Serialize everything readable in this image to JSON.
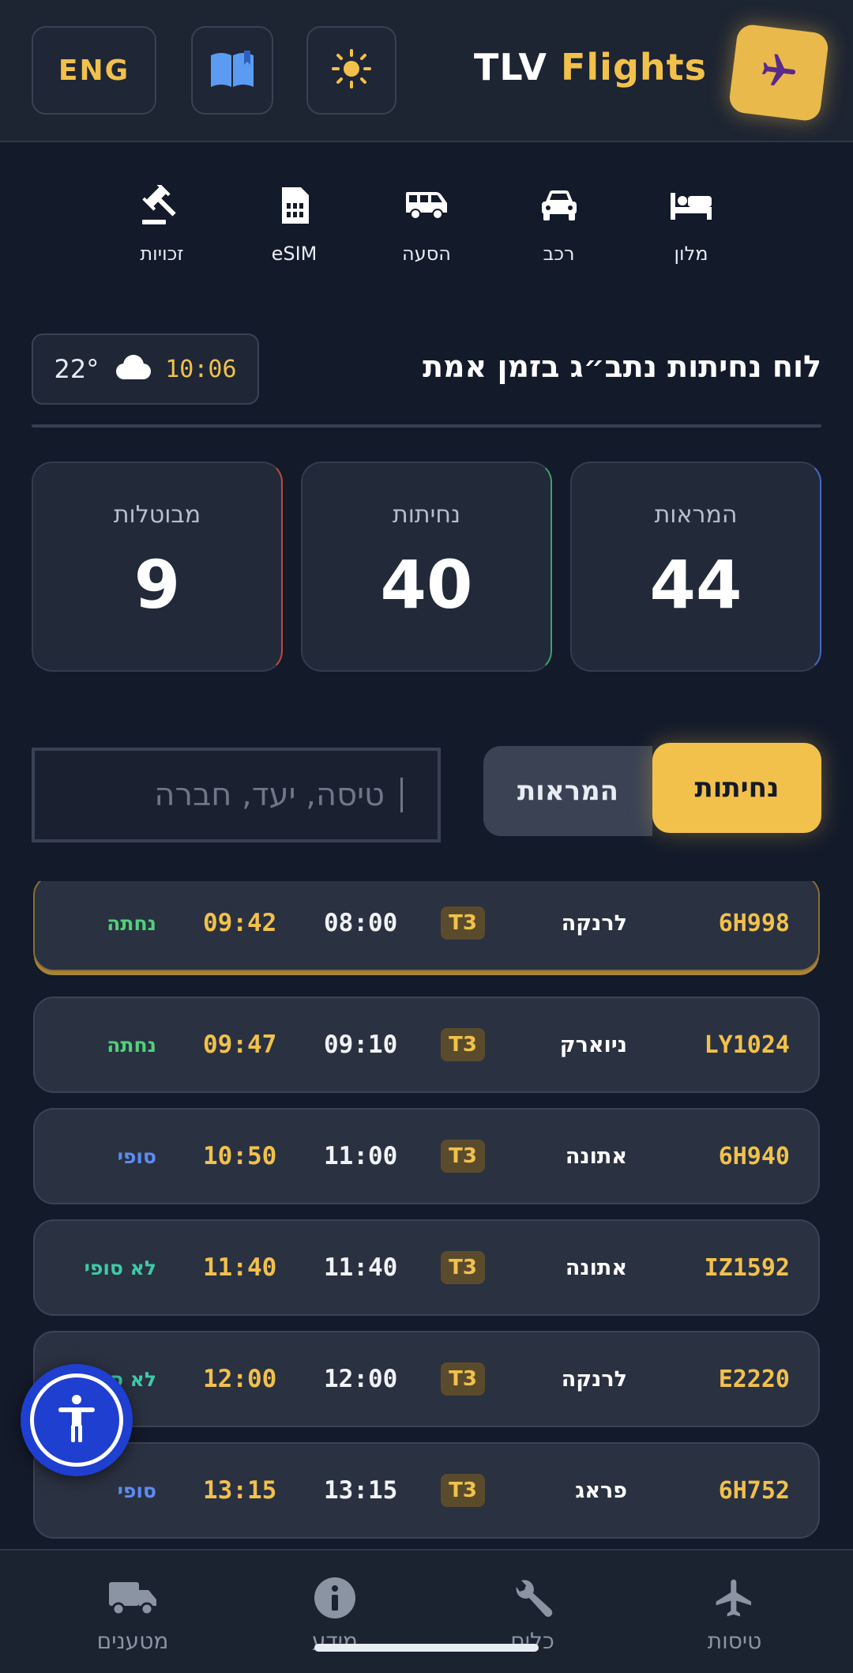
{
  "header": {
    "brand_prefix": "TLV",
    "brand_accent": "Flights",
    "language_button": "ENG",
    "guide_icon": "book-icon",
    "theme_icon": "sun-icon",
    "logo_icon": "airplane-icon"
  },
  "services": [
    {
      "label": "מלון",
      "icon": "bed-icon"
    },
    {
      "label": "רכב",
      "icon": "car-icon"
    },
    {
      "label": "הסעה",
      "icon": "shuttle-bus-icon"
    },
    {
      "label": "eSIM",
      "icon": "sim-card-icon"
    },
    {
      "label": "זכויות",
      "icon": "gavel-icon"
    }
  ],
  "board": {
    "title": "לוח נחיתות נתב״ג בזמן אמת",
    "clock": "10:06",
    "temperature": "22°",
    "weather_icon": "cloud-icon"
  },
  "stats": {
    "arrivals": {
      "label": "המראות",
      "value": "44"
    },
    "landings": {
      "label": "נחיתות",
      "value": "40"
    },
    "cancelled": {
      "label": "מבוטלות",
      "value": "9"
    }
  },
  "controls": {
    "tab_landings": "נחיתות",
    "tab_departures": "המראות",
    "search_placeholder": "טיסה, יעד, חברה"
  },
  "flights": [
    {
      "flight": "6H998",
      "destination": "לרנקה",
      "terminal": "T3",
      "scheduled": "08:00",
      "estimated": "09:42",
      "status": "נחתה",
      "status_color": "#4fd27a"
    },
    {
      "flight": "LY1024",
      "destination": "ניוארק",
      "terminal": "T3",
      "scheduled": "09:10",
      "estimated": "09:47",
      "status": "נחתה",
      "status_color": "#4fd27a"
    },
    {
      "flight": "6H940",
      "destination": "אתונה",
      "terminal": "T3",
      "scheduled": "11:00",
      "estimated": "10:50",
      "status": "סופי",
      "status_color": "#5b8cf2"
    },
    {
      "flight": "IZ1592",
      "destination": "אתונה",
      "terminal": "T3",
      "scheduled": "11:40",
      "estimated": "11:40",
      "status": "לא סופי",
      "status_color": "#3fc9a5"
    },
    {
      "flight": "E2220",
      "destination": "לרנקה",
      "terminal": "T3",
      "scheduled": "12:00",
      "estimated": "12:00",
      "status": "לא סופי",
      "status_color": "#3fc9a5"
    },
    {
      "flight": "6H752",
      "destination": "פראג",
      "terminal": "T3",
      "scheduled": "13:15",
      "estimated": "13:15",
      "status": "סופי",
      "status_color": "#5b8cf2"
    }
  ],
  "bottom_nav": [
    {
      "label": "טיסות",
      "icon": "airplane-icon"
    },
    {
      "label": "כלים",
      "icon": "wrench-icon"
    },
    {
      "label": "מידע",
      "icon": "info-icon"
    },
    {
      "label": "מטענים",
      "icon": "truck-icon"
    }
  ],
  "colors": {
    "accent": "#f2c14b",
    "background": "#131a2a",
    "card": "#2a3141"
  }
}
